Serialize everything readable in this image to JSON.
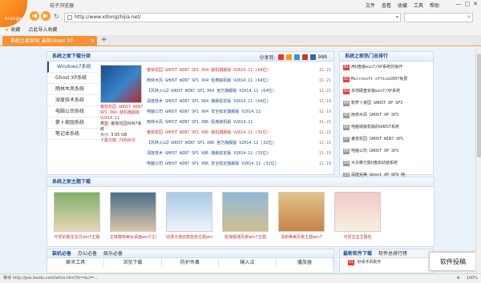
{
  "app": {
    "logo_text": "orange",
    "title": "桔子浏览器",
    "menu": [
      "文件",
      "查看",
      "收藏",
      "工具",
      "帮助"
    ],
    "window_controls": [
      "—",
      "□",
      "✕"
    ]
  },
  "nav": {
    "back_label": "◀",
    "forward_label": "▶",
    "refresh_label": "↻",
    "url": "http://www.xitongzhijia.net/"
  },
  "bookmarks": {
    "favorites": "收藏",
    "import": "点此导入收藏"
  },
  "tabs": [
    {
      "title": "系统之家官网_最新Ghost XP",
      "close": "✕"
    }
  ],
  "new_tab_label": "+",
  "content": {
    "downloads": {
      "title": "系统之家下载分类",
      "share_label": "分享到:",
      "share_count": "988",
      "categories": [
        "Windows7系统",
        "Ghost XP系统",
        "雨林木风系统",
        "深度技术系统",
        "电脑公司系统",
        "萝卜家园系统",
        "笔记本系统"
      ],
      "featured": {
        "caption": "番茄花园 GHOST WIN7 SP1 X64 装机旗舰版 V2014.11",
        "type": "类型: 番茄花园WIN7系统",
        "size": "大小: 3.95 GB",
        "downloads": "下载次数: 70695次"
      },
      "list": [
        {
          "title": "番茄花园 GHOST WIN7 SP1 X64 装机旗舰版 V2014.11 (64位)",
          "date": "11-21",
          "color": "#c33"
        },
        {
          "title": "雨林木风 GHOST WIN7 SP1 X64 经典装机版 V2014.11 (64位)",
          "date": "11-21",
          "color": "#1d4f91"
        },
        {
          "title": "【风林火山】GHOST WIN7 SP1 X64 官方旗舰版 V2014.11 (64位)",
          "date": "11-21",
          "color": "#1d4f91"
        },
        {
          "title": "深度技术 GHOST WIN7 SP1 X64 旗舰稳定版 V2014.11 (64位)",
          "date": "11-19",
          "color": "#1d4f91"
        },
        {
          "title": "电脑公司 GHOST WIN7 SP1 X64 安全稳定旗舰版 V2014.11",
          "date": "11-19",
          "color": "#1d4f91"
        },
        {
          "title": "雨林木风 GHOST WIN7 SP1 X86 经典装机版 V2014.11",
          "date": "11-21",
          "color": "#1d4f91"
        },
        {
          "title": "番茄花园 GHOST WIN7 SP1 X86 装机旗舰版 V2014.11 (32位)",
          "date": "11-21",
          "color": "#c33"
        },
        {
          "title": "【风林火山】GHOST WIN7 SP1 X86 官方旗舰版 V2014.11 (32位)",
          "date": "11-21",
          "color": "#1d4f91"
        },
        {
          "title": "深度技术 GHOST WIN7 SP1 X86 旗舰稳定版 V2014.11 (32位)",
          "date": "11-19",
          "color": "#1d4f91"
        },
        {
          "title": "电脑公司 GHOST WIN7 SP1 X86 安全稳定旗舰版 V2014.11 (32位)",
          "date": "11-19",
          "color": "#1d4f91"
        }
      ]
    },
    "hot": {
      "title": "系统之家热门总排行",
      "items": [
        {
          "num": "01",
          "text": "用U盘装win7/XP系统的操作"
        },
        {
          "num": "02",
          "text": "Microsoft office2007免费"
        },
        {
          "num": "03",
          "text": "本地硬盘安装win7/XP系统"
        },
        {
          "num": "04",
          "text": "新萝卜家园 GHOST XP SP3"
        },
        {
          "num": "05",
          "text": "雨林木风 GHOST XP SP3"
        },
        {
          "num": "06",
          "text": "电脑城装机版的GHOST系统"
        },
        {
          "num": "07",
          "text": "番茄花园 GHOST WIN7 SP1"
        },
        {
          "num": "08",
          "text": "电脑公司 GHOST XP SP3"
        },
        {
          "num": "09",
          "text": "大白菜万能U盘启动装系统"
        },
        {
          "num": "10",
          "text": "深度完美 Ghost XP SP3 纯"
        }
      ]
    },
    "newest": {
      "title": "系统之家主题下载",
      "items": [
        {
          "caption": "可爱的婴宝宝贝win7主题"
        },
        {
          "caption": "正妹模特美女桌面win7主题"
        },
        {
          "caption": "动漫卡通创意蓝色主题win7"
        },
        {
          "caption": "碧海银滩风景win7主题"
        },
        {
          "caption": "清新唯美风景主题win7"
        },
        {
          "caption": "可爱宝宝主题包"
        }
      ]
    },
    "bottom": {
      "tabs": [
        "装机必备",
        "办公必备",
        "娱乐必备"
      ],
      "headers": [
        "聊天工具",
        "浏览下载",
        "防护杀毒",
        "输入法",
        "播放器"
      ]
    },
    "bottom_right": {
      "tabs": [
        "最新软件下载",
        "软件总排行榜"
      ],
      "item_num": "01",
      "item": "好桌手机助手"
    },
    "float_button": "软件投稿"
  },
  "status": {
    "text": "等待 http://pos.baidu.com/wh/o.htm?ltr=&cf=...",
    "zoom": "100%"
  }
}
